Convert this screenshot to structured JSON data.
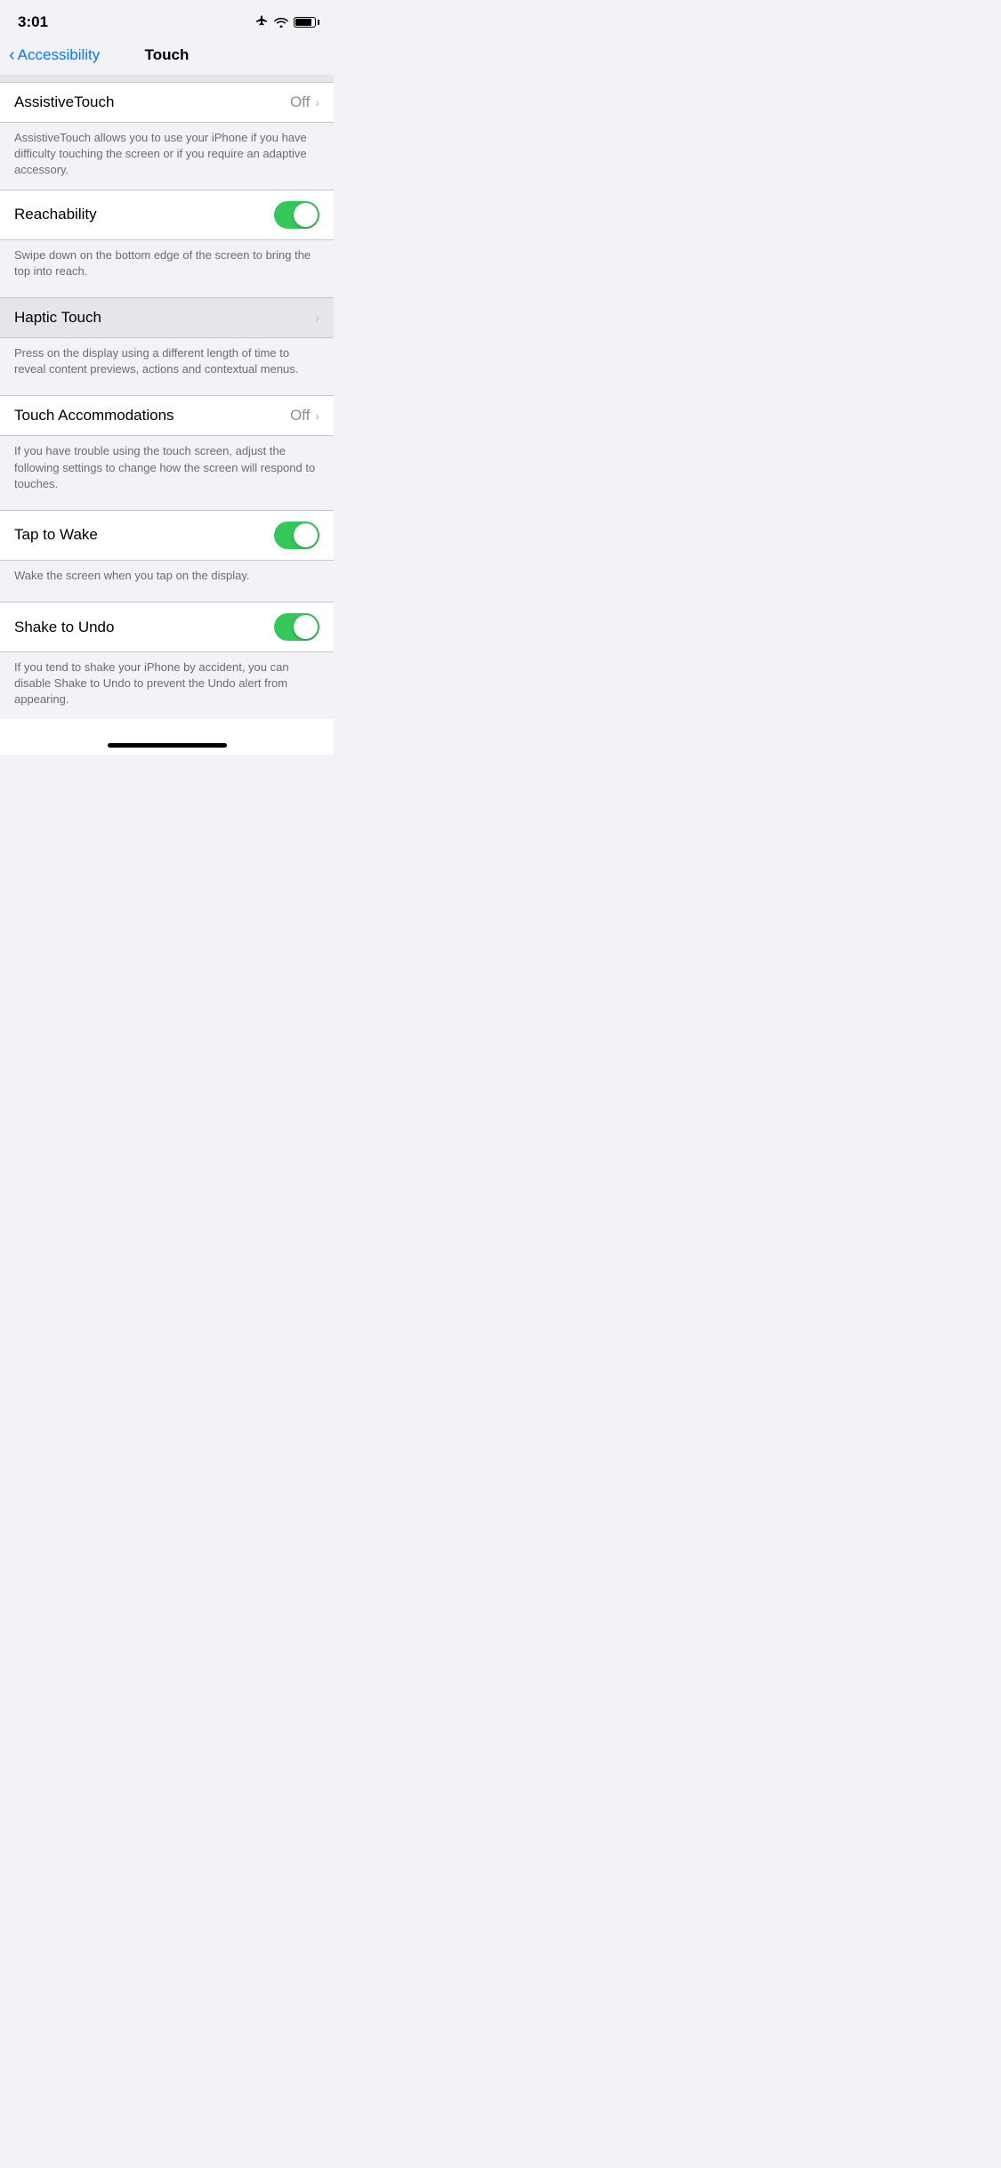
{
  "statusBar": {
    "time": "3:01"
  },
  "navBar": {
    "backLabel": "Accessibility",
    "title": "Touch"
  },
  "settings": {
    "assistiveTouch": {
      "label": "AssistiveTouch",
      "value": "Off",
      "description": "AssistiveTouch allows you to use your iPhone if you have difficulty touching the screen or if you require an adaptive accessory."
    },
    "reachability": {
      "label": "Reachability",
      "enabled": true,
      "description": "Swipe down on the bottom edge of the screen to bring the top into reach."
    },
    "hapticTouch": {
      "label": "Haptic Touch",
      "description": "Press on the display using a different length of time to reveal content previews, actions and contextual menus."
    },
    "touchAccommodations": {
      "label": "Touch Accommodations",
      "value": "Off",
      "description": "If you have trouble using the touch screen, adjust the following settings to change how the screen will respond to touches."
    },
    "tapToWake": {
      "label": "Tap to Wake",
      "enabled": true,
      "description": "Wake the screen when you tap on the display."
    },
    "shakeToUndo": {
      "label": "Shake to Undo",
      "enabled": true,
      "description": "If you tend to shake your iPhone by accident, you can disable Shake to Undo to prevent the Undo alert from appearing."
    }
  }
}
